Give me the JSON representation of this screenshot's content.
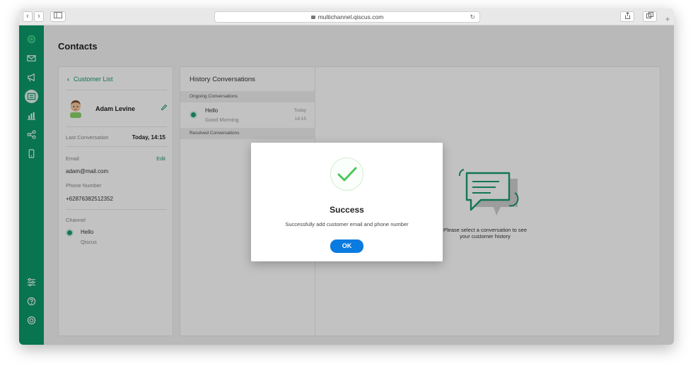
{
  "browser": {
    "url": "multichannel.qiscus.com",
    "back_glyph": "‹",
    "forward_glyph": "›",
    "new_tab_glyph": "+"
  },
  "page": {
    "title": "Contacts"
  },
  "customer_panel": {
    "back_label": "Customer List",
    "name": "Adam Levine",
    "last_conversation_label": "Last Conversation",
    "last_conversation_value": "Today, 14:15",
    "email_label": "Email",
    "email_edit": "Edit",
    "email_value": "adam@mail.com",
    "phone_label": "Phone Number",
    "phone_value": "+62876382512352",
    "channel_label": "Channel",
    "channel_name": "Hello",
    "channel_sub": "Qiscus"
  },
  "history_panel": {
    "title": "History Conversations",
    "ongoing_label": "Ongoing Conversations",
    "resolved_label": "Resolved Conversations",
    "conversations": [
      {
        "title": "Hello",
        "preview": "Good Morning",
        "day": "Today",
        "time": "14:15"
      }
    ]
  },
  "detail_panel": {
    "empty_line1": "Please select a conversation to see",
    "empty_line2": "your customer history"
  },
  "modal": {
    "title": "Success",
    "message": "Successfully add customer email and phone number",
    "ok_label": "OK"
  },
  "colors": {
    "brand_green": "#0d9a6a",
    "accent_blue": "#0a7be0",
    "success_green": "#4cc75a"
  }
}
